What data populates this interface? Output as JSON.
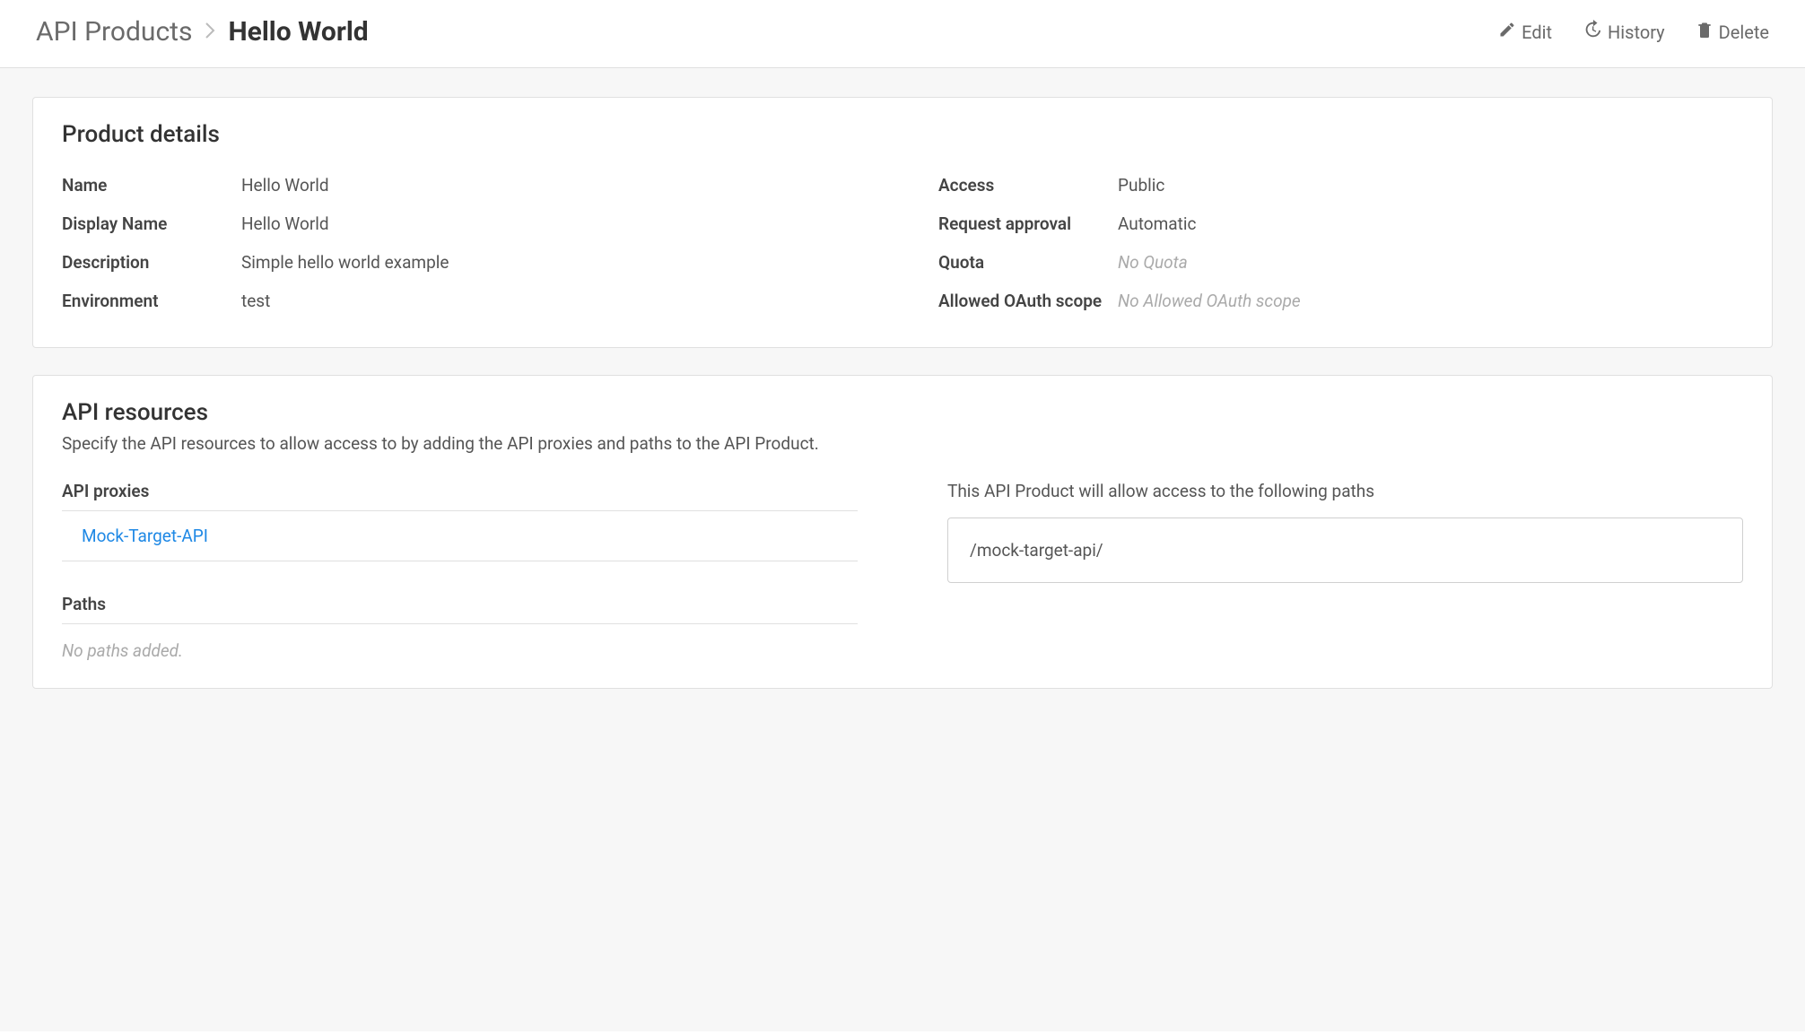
{
  "breadcrumb": {
    "root": "API Products",
    "current": "Hello World"
  },
  "actions": {
    "edit": "Edit",
    "history": "History",
    "delete": "Delete"
  },
  "details": {
    "title": "Product details",
    "left": {
      "name_label": "Name",
      "name_value": "Hello World",
      "display_name_label": "Display Name",
      "display_name_value": "Hello World",
      "description_label": "Description",
      "description_value": "Simple hello world example",
      "environment_label": "Environment",
      "environment_value": "test"
    },
    "right": {
      "access_label": "Access",
      "access_value": "Public",
      "approval_label": "Request approval",
      "approval_value": "Automatic",
      "quota_label": "Quota",
      "quota_value": "No Quota",
      "oauth_label": "Allowed OAuth scope",
      "oauth_value": "No Allowed OAuth scope"
    }
  },
  "resources": {
    "title": "API resources",
    "subtitle": "Specify the API resources to allow access to by adding the API proxies and paths to the API Product.",
    "proxies_label": "API proxies",
    "proxies": [
      "Mock-Target-API"
    ],
    "paths_label": "Paths",
    "paths_empty": "No paths added.",
    "access_paths_label": "This API Product will allow access to the following paths",
    "access_paths": [
      "/mock-target-api/"
    ]
  }
}
